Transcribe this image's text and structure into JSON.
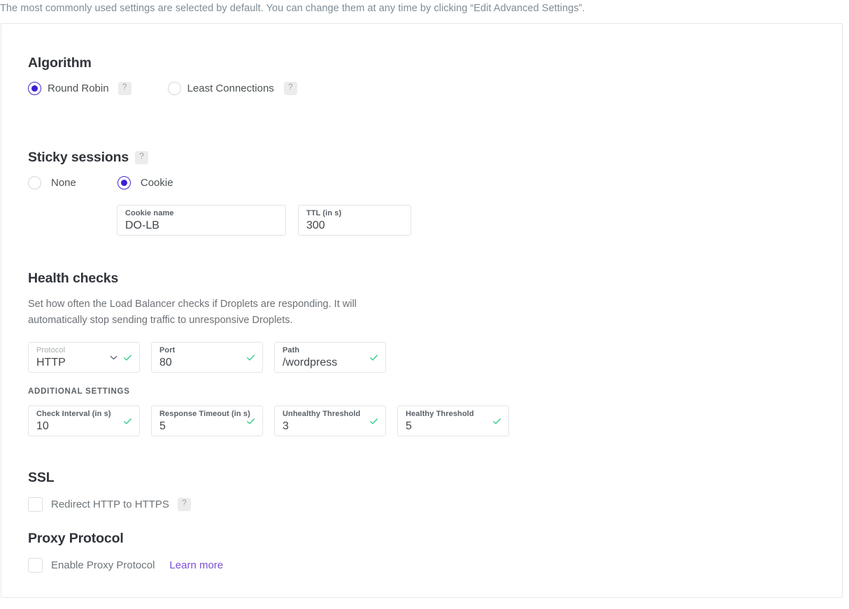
{
  "intro_text": "The most commonly used settings are selected by default. You can change them at any time by clicking “Edit Advanced Settings”.",
  "colors": {
    "accent_purple": "#3d1fd4",
    "link_purple": "#7b4fd4",
    "success_green": "#3ecf8e",
    "card_border": "#e5e8ea",
    "field_border": "#e2e5e7",
    "heading": "#31353b",
    "body_text": "#6d7277"
  },
  "icons": {
    "help": "?",
    "check": "check-icon",
    "chevron": "chevron-down-icon"
  },
  "algorithm": {
    "heading": "Algorithm",
    "options": [
      {
        "label": "Round Robin",
        "selected": true,
        "help": "?"
      },
      {
        "label": "Least Connections",
        "selected": false,
        "help": "?"
      }
    ]
  },
  "sticky_sessions": {
    "heading": "Sticky sessions",
    "help": "?",
    "options": [
      {
        "label": "None",
        "selected": false
      },
      {
        "label": "Cookie",
        "selected": true
      }
    ],
    "fields": [
      {
        "label": "Cookie name",
        "value": "DO-LB"
      },
      {
        "label": "TTL (in s)",
        "value": "300"
      }
    ]
  },
  "health_checks": {
    "heading": "Health checks",
    "description": "Set how often the Load Balancer checks if Droplets are responding. It will automatically stop sending traffic to unresponsive Droplets.",
    "primary_fields": [
      {
        "label": "Protocol",
        "value": "HTTP",
        "dropdown": true,
        "valid": true,
        "label_muted": true
      },
      {
        "label": "Port",
        "value": "80",
        "dropdown": false,
        "valid": true,
        "label_muted": false
      },
      {
        "label": "Path",
        "value": "/wordpress",
        "dropdown": false,
        "valid": true,
        "label_muted": false
      }
    ],
    "additional_heading": "ADDITIONAL SETTINGS",
    "additional_fields": [
      {
        "label": "Check Interval (in s)",
        "value": "10",
        "valid": true
      },
      {
        "label": "Response Timeout (in s)",
        "value": "5",
        "valid": true
      },
      {
        "label": "Unhealthy Threshold",
        "value": "3",
        "valid": true
      },
      {
        "label": "Healthy Threshold",
        "value": "5",
        "valid": true
      }
    ]
  },
  "ssl": {
    "heading": "SSL",
    "checkbox_label": "Redirect HTTP to HTTPS",
    "checked": false,
    "help": "?"
  },
  "proxy_protocol": {
    "heading": "Proxy Protocol",
    "checkbox_label": "Enable Proxy Protocol",
    "checked": false,
    "link_label": "Learn more"
  }
}
